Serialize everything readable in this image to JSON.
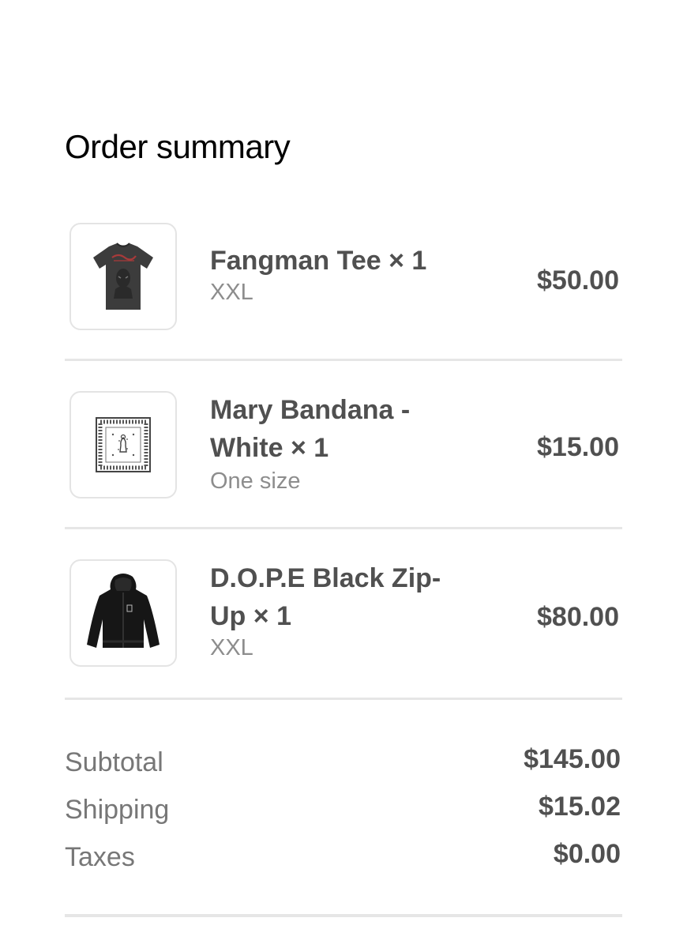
{
  "title": "Order summary",
  "items": [
    {
      "name": "Fangman Tee × 1",
      "variant": "XXL",
      "price": "$50.00",
      "image": "tshirt-image"
    },
    {
      "name": "Mary Bandana - White × 1",
      "variant": "One size",
      "price": "$15.00",
      "image": "bandana-image"
    },
    {
      "name": "D.O.P.E Black Zip-Up × 1",
      "variant": "XXL",
      "price": "$80.00",
      "image": "hoodie-image"
    }
  ],
  "summary": {
    "subtotal_label": "Subtotal",
    "subtotal_value": "$145.00",
    "shipping_label": "Shipping",
    "shipping_value": "$15.02",
    "taxes_label": "Taxes",
    "taxes_value": "$0.00"
  },
  "colors": {
    "text_primary": "#505050",
    "text_secondary": "#8d8d8d",
    "divider": "#e6e6e6",
    "tee_print_accent": "#a83a3a"
  }
}
